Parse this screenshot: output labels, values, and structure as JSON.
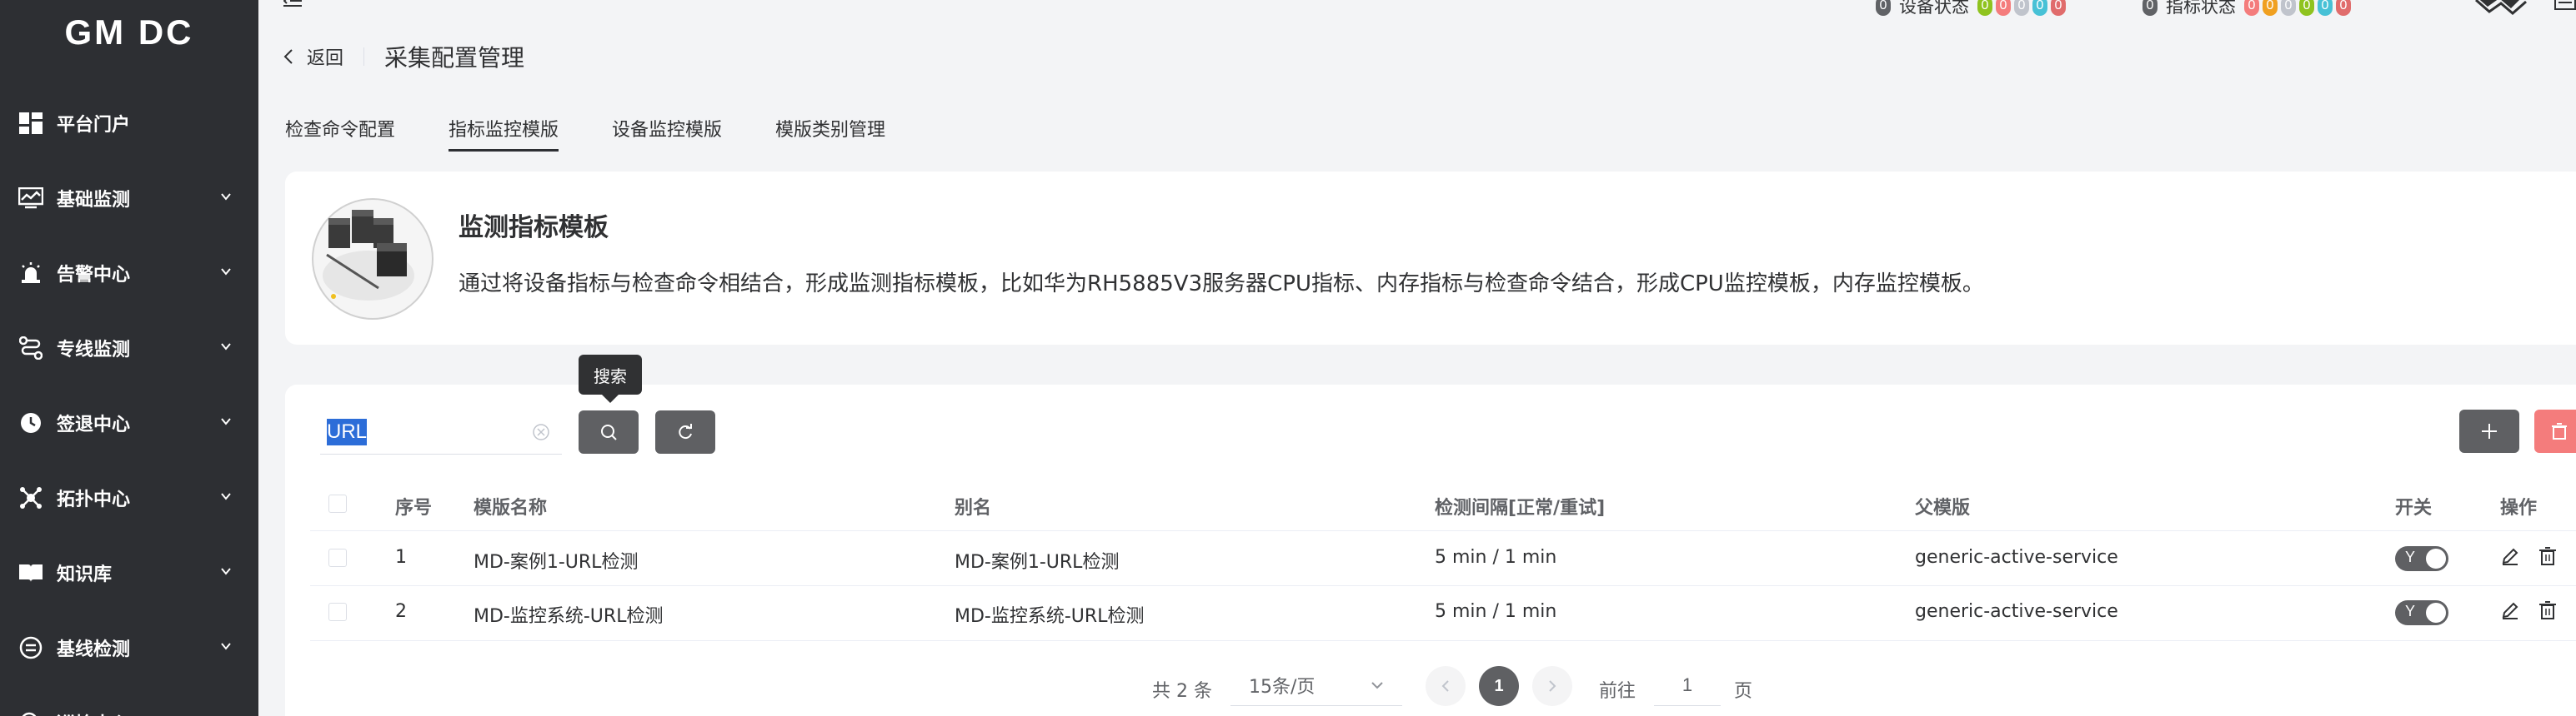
{
  "sidebar": {
    "logo": "GM DC",
    "items": [
      {
        "label": "平台门户",
        "icon": "dashboard-icon"
      },
      {
        "label": "基础监测",
        "icon": "monitor-chart-icon"
      },
      {
        "label": "告警中心",
        "icon": "alarm-icon"
      },
      {
        "label": "专线监测",
        "icon": "route-icon"
      },
      {
        "label": "签退中心",
        "icon": "clock-icon"
      },
      {
        "label": "拓扑中心",
        "icon": "topology-icon"
      },
      {
        "label": "知识库",
        "icon": "book-icon"
      },
      {
        "label": "基线检测",
        "icon": "baseline-icon"
      },
      {
        "label": "巡检中心",
        "icon": "inspect-icon"
      }
    ]
  },
  "header": {
    "device_status": {
      "label": "设备状态",
      "total": "0",
      "counts": [
        {
          "value": "0",
          "color": "#8fc31f"
        },
        {
          "value": "0",
          "color": "#f47c7c"
        },
        {
          "value": "0",
          "color": "#c0c4cc"
        },
        {
          "value": "0",
          "color": "#47c1d6"
        },
        {
          "value": "0",
          "color": "#e06c6c"
        }
      ]
    },
    "metric_status": {
      "label": "指标状态",
      "total": "0",
      "counts": [
        {
          "value": "0",
          "color": "#f47c7c"
        },
        {
          "value": "0",
          "color": "#f0a020"
        },
        {
          "value": "0",
          "color": "#c0c4cc"
        },
        {
          "value": "0",
          "color": "#8fc31f"
        },
        {
          "value": "0",
          "color": "#47c1d6"
        },
        {
          "value": "0",
          "color": "#e06c6c"
        }
      ]
    }
  },
  "breadcrumb": {
    "back_label": "返回",
    "title": "采集配置管理"
  },
  "tabs": [
    {
      "label": "检查命令配置",
      "active": false
    },
    {
      "label": "指标监控模版",
      "active": true
    },
    {
      "label": "设备监控模版",
      "active": false
    },
    {
      "label": "模版类别管理",
      "active": false
    }
  ],
  "intro": {
    "title": "监测指标模板",
    "description": "通过将设备指标与检查命令相结合，形成监测指标模板，比如华为RH5885V3服务器CPU指标、内存指标与检查命令结合，形成CPU监控模板，内存监控模板。"
  },
  "toolbar": {
    "search_value": "URL",
    "search_tooltip": "搜索"
  },
  "table": {
    "columns": [
      "序号",
      "模版名称",
      "别名",
      "检测间隔[正常/重试]",
      "父模版",
      "开关",
      "操作"
    ],
    "rows": [
      {
        "index": "1",
        "name": "MD-案例1-URL检测",
        "alias": "MD-案例1-URL检测",
        "interval": "5 min / 1 min",
        "parent": "generic-active-service",
        "switch": "Y"
      },
      {
        "index": "2",
        "name": "MD-监控系统-URL检测",
        "alias": "MD-监控系统-URL检测",
        "interval": "5 min / 1 min",
        "parent": "generic-active-service",
        "switch": "Y"
      }
    ]
  },
  "pagination": {
    "total_text": "共 2 条",
    "page_size": "15条/页",
    "current_page": "1",
    "goto_label": "前往",
    "goto_value": "1",
    "page_label": "页"
  },
  "colors": {
    "sidebar_bg": "#2d2f33",
    "button_dark": "#5f6063",
    "button_danger": "#f47c7c",
    "search_highlight": "#2c6dd8"
  }
}
